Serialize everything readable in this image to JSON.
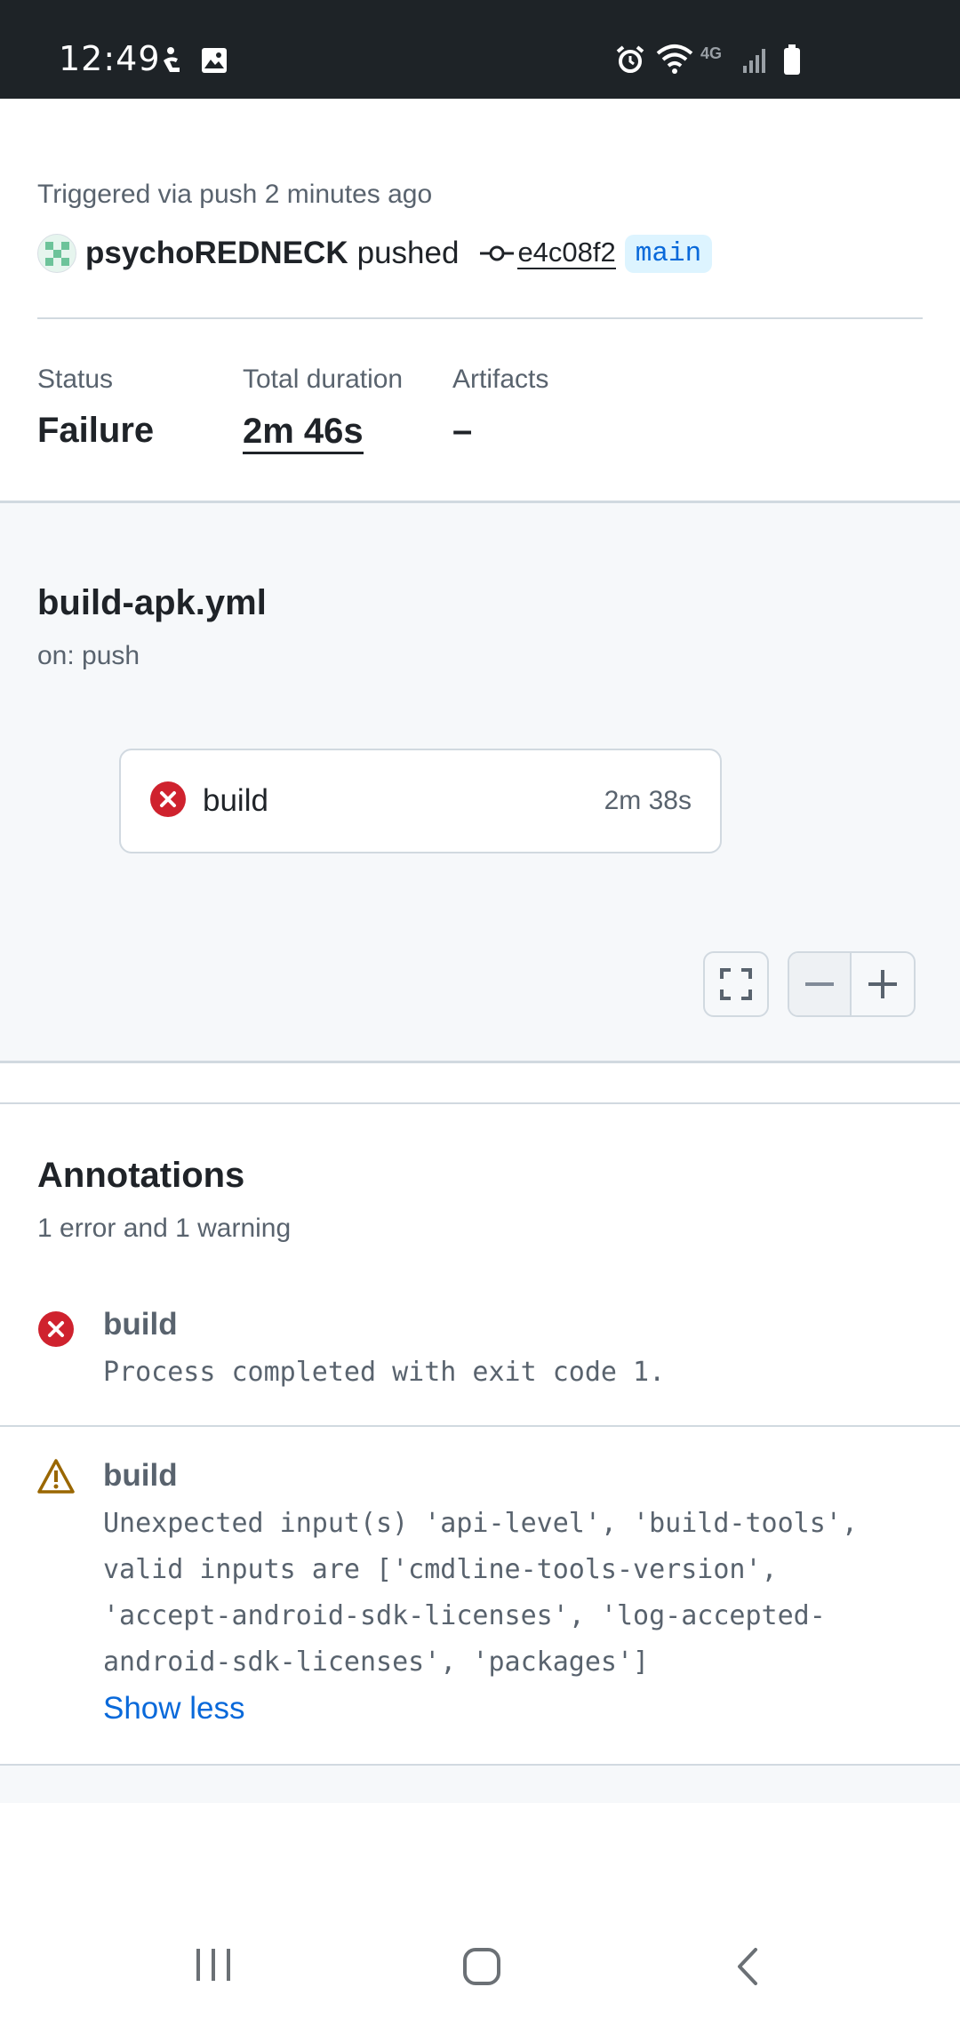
{
  "status_bar": {
    "time": "12:49",
    "icons": [
      "accessibility-icon",
      "gallery-icon",
      "alarm-icon",
      "wifi-icon",
      "4g-icon",
      "signal-icon",
      "battery-icon"
    ],
    "network_label": "4G"
  },
  "run": {
    "triggered_text": "Triggered via push 2 minutes ago",
    "pusher": "psychoREDNECK",
    "pushed_word": "pushed",
    "commit_sha": "e4c08f2",
    "branch": "main"
  },
  "meta": {
    "status_label": "Status",
    "status_value": "Failure",
    "duration_label": "Total duration",
    "duration_value": "2m 46s",
    "artifacts_label": "Artifacts",
    "artifacts_value": "–"
  },
  "workflow": {
    "file_name": "build-apk.yml",
    "trigger": "on: push",
    "jobs": [
      {
        "name": "build",
        "duration": "2m 38s",
        "status": "failure"
      }
    ]
  },
  "annotations": {
    "title": "Annotations",
    "summary": "1 error and 1 warning",
    "items": [
      {
        "type": "error",
        "job": "build",
        "message": "Process completed with exit code 1."
      },
      {
        "type": "warning",
        "job": "build",
        "message": "Unexpected input(s) 'api-level', 'build-tools', valid inputs are ['cmdline-tools-version', 'accept-android-sdk-licenses', 'log-accepted-android-sdk-licenses', 'packages']",
        "toggle_label": "Show less"
      }
    ]
  },
  "colors": {
    "error": "#cf222e",
    "warning": "#9a6700",
    "link": "#0969da",
    "branch_bg": "#ddf4ff",
    "status_bar_bg": "#1e2327"
  },
  "nav_bar": {
    "buttons": [
      "recent-apps-icon",
      "home-icon",
      "back-icon"
    ]
  }
}
